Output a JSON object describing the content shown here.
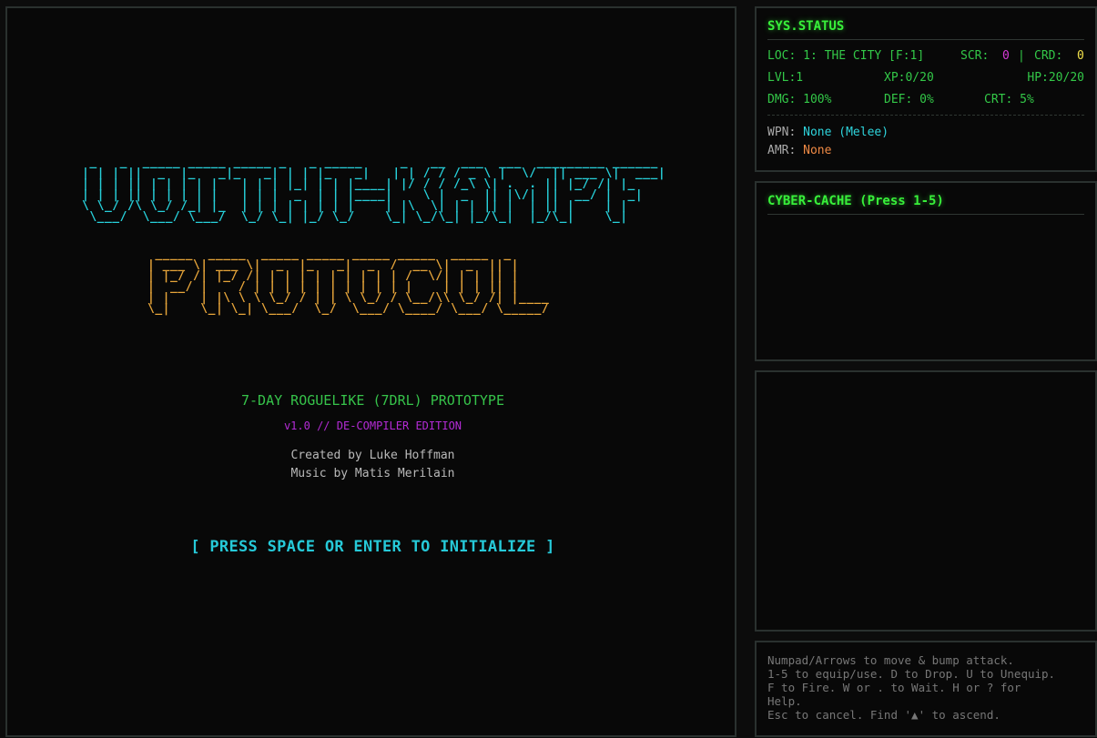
{
  "title_screen": {
    "logo_line1_ascii": " _   _  _____ _____ _____ _   _ _____     _   __  ___  ___  _________ ______ \n| | | ||  _  |_   _|_   _| | | |_   _|   | | / / / _ \\ |  \\/  || ___ \\|  ___|\n| | | || | | | | |   | | | |_| | | |____| |/ / / /_\\ \\| .  . || |_/ /| |_   \n| | | || | | | | |   | | |  _  | | |____|    \\ |  _  || |\\/| ||  __/ |  _|  \n\\ \\_/ /\\ \\_/ /_| |_  | | | | | | | |    | |\\  \\| | | || |  | || |    | |    \n \\___/  \\___/ \\___/  \\_/ \\_| |_/ \\_/    \\_| \\_/\\_| |_/\\_|  |_/\\_|    \\_|    ",
    "logo_line2_ascii": " _____  _____  _____ _____ _____ _____  _____  _     \n| ___ \\| ___ \\|  _  |_   _|  _  /  __ \\|  _  || |    \n| |_/ /| |_/ /| | | | | | | | | | /  \\/| | | || |    \n|  __/ |    / | | | | | | | | | | |    | | | || |    \n| |    | |\\ \\ \\ \\_/ / | | \\ \\_/ / \\__/\\\\ \\_/ /| |____\n\\_|    \\_| \\_| \\___/  \\_/  \\___/ \\____/ \\___/ \\_____/",
    "subtitle": "7-DAY ROGUELIKE (7DRL) PROTOTYPE",
    "version": "v1.0 // DE-COMPILER EDITION",
    "credit_1": "Created by Luke Hoffman",
    "credit_2": "Music by Matis Merilain",
    "prompt": "[ PRESS SPACE OR ENTER TO INITIALIZE ]"
  },
  "status": {
    "title": "SYS.STATUS",
    "loc": "LOC: 1: THE CITY [F:1]",
    "scr_label": "SCR:",
    "scr_value": "0",
    "crd_sep": "|",
    "crd_label": "CRD:",
    "crd_value": "0",
    "lvl": "LVL:1",
    "xp": "XP:0/20",
    "hp": "HP:20/20",
    "dmg": "DMG: 100%",
    "def": "DEF: 0%",
    "crt": "CRT: 5%",
    "wpn_label": "WPN:",
    "wpn_value": "None (Melee)",
    "amr_label": "AMR:",
    "amr_value": "None"
  },
  "cache": {
    "title": "CYBER-CACHE (Press 1-5)"
  },
  "help": {
    "text": "Numpad/Arrows to move & bump attack.\n1-5 to equip/use. D to Drop. U to Unequip.\nF to Fire. W or . to Wait. H or ? for\nHelp.\nEsc to cancel. Find '▲' to ascend."
  },
  "colors": {
    "cyan": "#27d0da",
    "orange": "#e7a53a",
    "green": "#33c848",
    "magenta": "#b42bd6",
    "yellow": "#f2e14b"
  }
}
